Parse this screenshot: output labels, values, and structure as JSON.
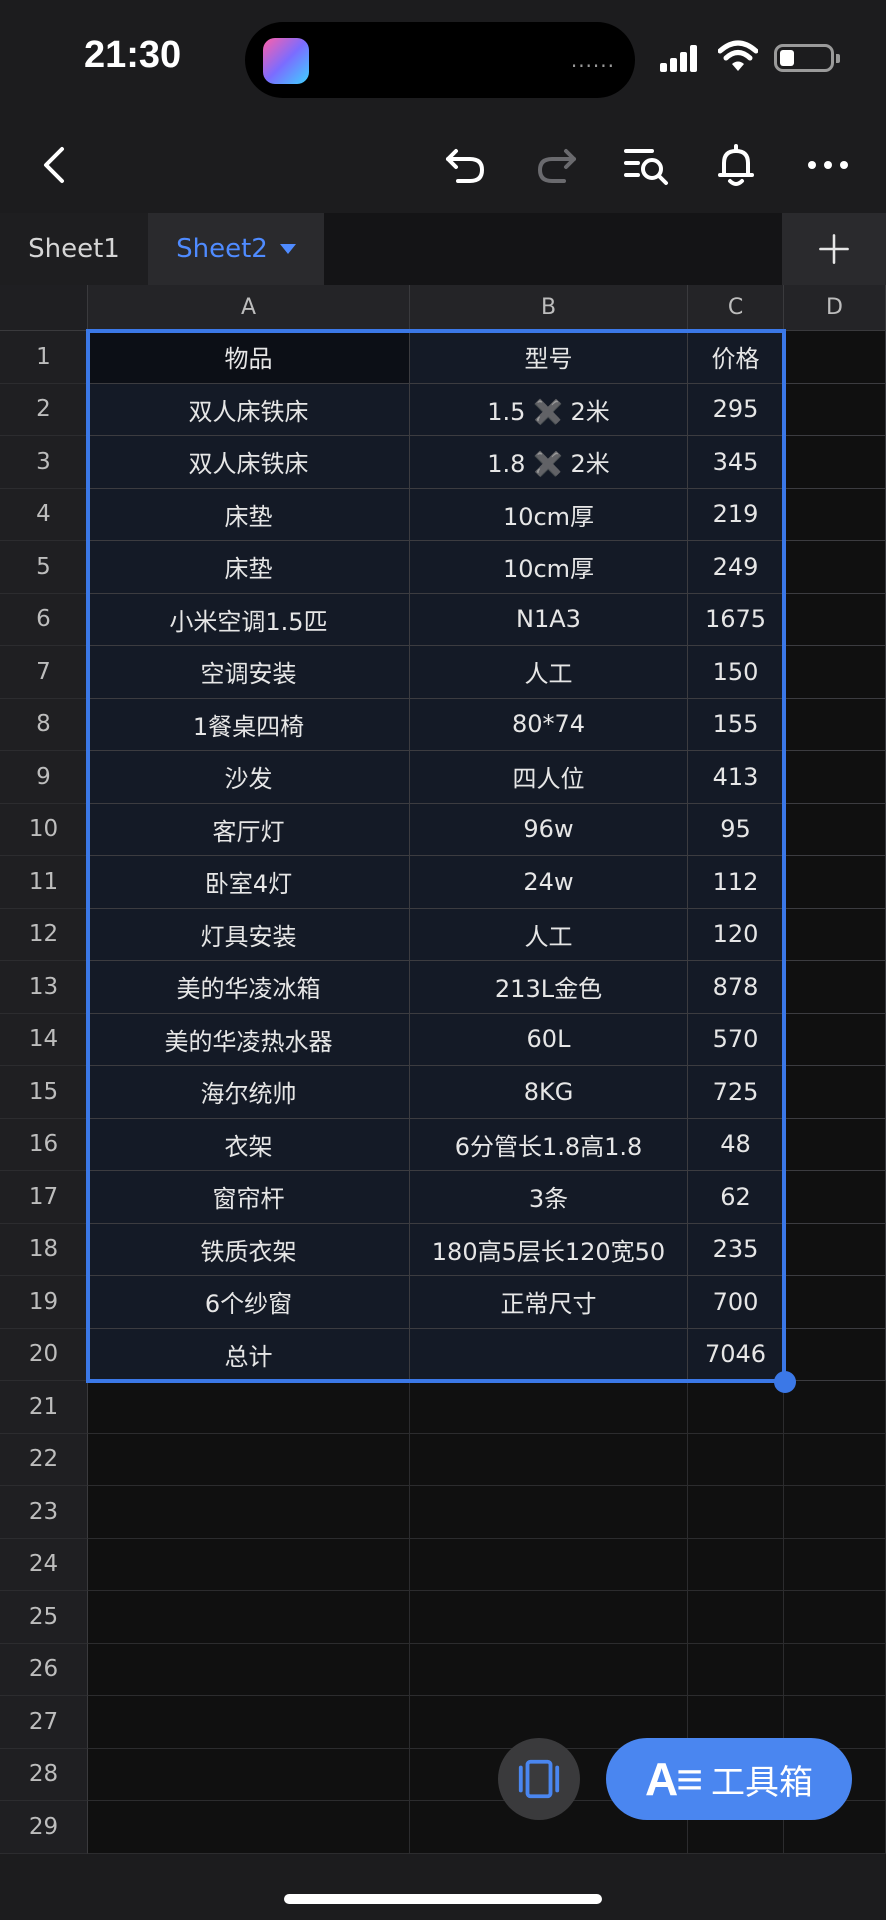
{
  "status_bar": {
    "time": "21:30",
    "island_dots": "......"
  },
  "toolbar": {
    "back": "back-icon",
    "undo": "undo-icon",
    "redo": "redo-icon",
    "find": "find-icon",
    "bell": "bell-icon",
    "more": "more-icon"
  },
  "tabs": [
    {
      "label": "Sheet1",
      "active": false
    },
    {
      "label": "Sheet2",
      "active": true
    }
  ],
  "add_tab_label": "+",
  "columns": [
    "A",
    "B",
    "C",
    "D"
  ],
  "rows": [
    {
      "n": "1",
      "a": "物品",
      "b": "型号",
      "c": "价格"
    },
    {
      "n": "2",
      "a": "双人床铁床",
      "b": "1.5 ✖️ 2米",
      "c": "295"
    },
    {
      "n": "3",
      "a": "双人床铁床",
      "b": "1.8 ✖️ 2米",
      "c": "345"
    },
    {
      "n": "4",
      "a": "床垫",
      "b": "10cm厚",
      "c": "219"
    },
    {
      "n": "5",
      "a": "床垫",
      "b": "10cm厚",
      "c": "249"
    },
    {
      "n": "6",
      "a": "小米空调1.5匹",
      "b": "N1A3",
      "c": "1675"
    },
    {
      "n": "7",
      "a": "空调安装",
      "b": "人工",
      "c": "150"
    },
    {
      "n": "8",
      "a": "1餐桌四椅",
      "b": "80*74",
      "c": "155"
    },
    {
      "n": "9",
      "a": "沙发",
      "b": "四人位",
      "c": "413"
    },
    {
      "n": "10",
      "a": "客厅灯",
      "b": "96w",
      "c": "95"
    },
    {
      "n": "11",
      "a": "卧室4灯",
      "b": "24w",
      "c": "112"
    },
    {
      "n": "12",
      "a": "灯具安装",
      "b": "人工",
      "c": "120"
    },
    {
      "n": "13",
      "a": "美的华凌冰箱",
      "b": "213L金色",
      "c": "878"
    },
    {
      "n": "14",
      "a": "美的华凌热水器",
      "b": "60L",
      "c": "570"
    },
    {
      "n": "15",
      "a": "海尔统帅",
      "b": "8KG",
      "c": "725"
    },
    {
      "n": "16",
      "a": "衣架",
      "b": "6分管长1.8高1.8",
      "c": "48"
    },
    {
      "n": "17",
      "a": "窗帘杆",
      "b": "3条",
      "c": "62"
    },
    {
      "n": "18",
      "a": "铁质衣架",
      "b": "180高5层长120宽50",
      "c": "235"
    },
    {
      "n": "19",
      "a": "6个纱窗",
      "b": "正常尺寸",
      "c": "700"
    },
    {
      "n": "20",
      "a": "总计",
      "b": "",
      "c": "7046"
    }
  ],
  "empty_rows": [
    "21",
    "22",
    "23",
    "24",
    "25",
    "26",
    "27",
    "28",
    "29"
  ],
  "toolbox_button": {
    "glyph": "A≡",
    "label": "工具箱"
  },
  "accent_color": "#4a86f0"
}
